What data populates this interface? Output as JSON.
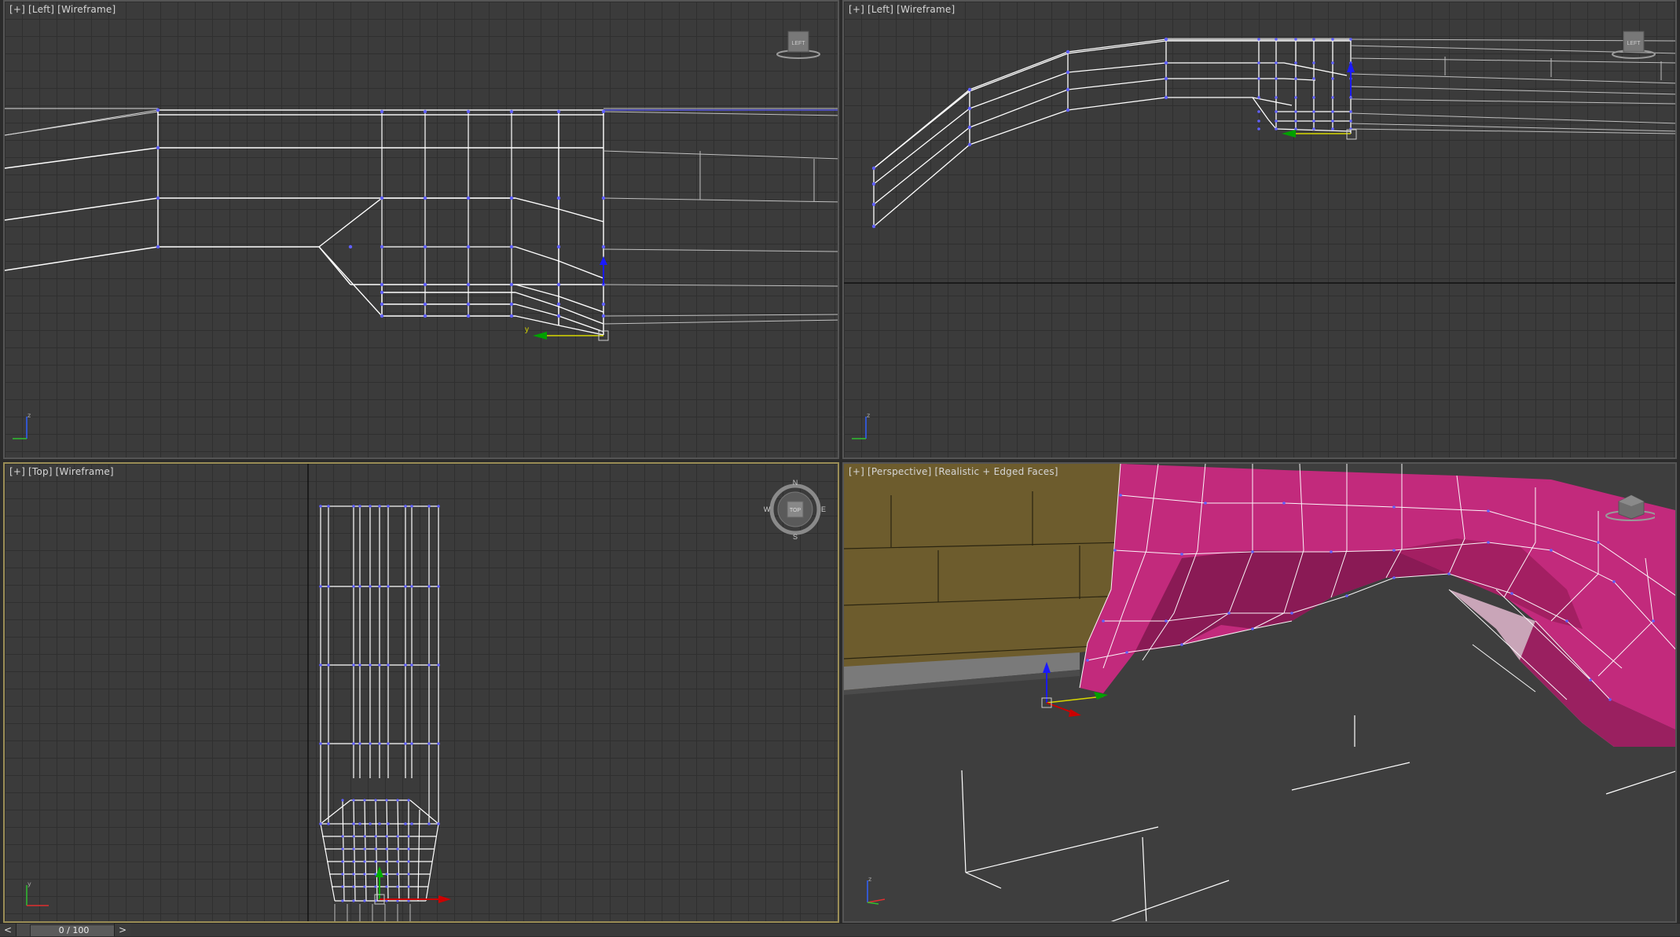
{
  "viewports": {
    "top_left": {
      "label": "[+] [Left] [Wireframe]",
      "cube": "LEFT"
    },
    "top_right": {
      "label": "[+] [Left] [Wireframe]",
      "cube": "LEFT"
    },
    "bottom_left": {
      "label": "[+] [Top] [Wireframe]",
      "cube": "TOP",
      "compass": {
        "n": "N",
        "s": "S",
        "e": "E",
        "w": "W"
      }
    },
    "bottom_right": {
      "label": "[+] [Perspective] [Realistic + Edged Faces]"
    }
  },
  "axes": {
    "x": "x",
    "y": "y",
    "z": "z"
  },
  "timeline": {
    "prev": "<",
    "frame": "0 / 100",
    "next": ">"
  },
  "colors": {
    "wire": "#ffffff",
    "vertex": "#5a5aff",
    "mesh_pink": "#c22a7c",
    "wall": "#6b5a2f",
    "active_border": "#9a8d56"
  }
}
